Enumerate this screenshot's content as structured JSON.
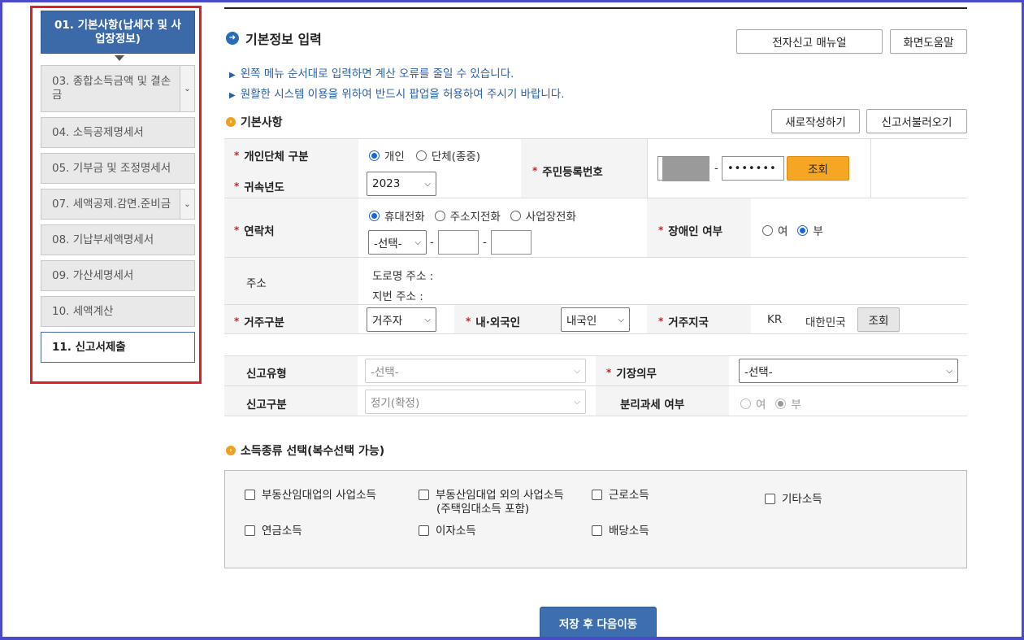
{
  "sidebar": {
    "items": [
      {
        "label": "01. 기본사항(납세자 및 사업장정보)",
        "state": "active"
      },
      {
        "label": "03. 종합소득금액 및 결손금",
        "state": "expandable"
      },
      {
        "label": "04. 소득공제명세서",
        "state": "normal"
      },
      {
        "label": "05. 기부금 및 조정명세서",
        "state": "normal"
      },
      {
        "label": "07. 세액공제.감면.준비금",
        "state": "expandable"
      },
      {
        "label": "08. 기납부세액명세서",
        "state": "normal"
      },
      {
        "label": "09. 가산세명세서",
        "state": "normal"
      },
      {
        "label": "10. 세액계산",
        "state": "normal"
      },
      {
        "label": "11. 신고서제출",
        "state": "current"
      }
    ]
  },
  "header": {
    "title": "기본정보 입력",
    "manual_button": "전자신고 매뉴얼",
    "help_button": "화면도움말",
    "notices": [
      "왼쪽 메뉴 순서대로 입력하면 계산 오류를 줄일 수 있습니다.",
      "원활한 시스템 이용을 위하여 반드시 팝업을 허용하여 주시기 바랍니다."
    ]
  },
  "basic": {
    "title": "기본사항",
    "new_button": "새로작성하기",
    "load_button": "신고서불러오기",
    "type_label": "개인단체 구분",
    "type_options": [
      "개인",
      "단체(종중)"
    ],
    "type_selected": "개인",
    "year_label": "귀속년도",
    "year_value": "2023",
    "rrn_label": "주민등록번호",
    "rrn_dash": "-",
    "rrn_masked": "•••••••",
    "rrn_lookup": "조회",
    "contact_label": "연락처",
    "contact_options": [
      "휴대전화",
      "주소지전화",
      "사업장전화"
    ],
    "contact_selected": "휴대전화",
    "phone_select": "-선택-",
    "phone_dash": "-",
    "disabled_label": "장애인 여부",
    "disabled_options": [
      "여",
      "부"
    ],
    "disabled_selected": "부",
    "address_label": "주소",
    "road_address": "도로명 주소 :",
    "lot_address": "지번 주소 :",
    "residence_label": "거주구분",
    "residence_value": "거주자",
    "nationality_label": "내·외국인",
    "nationality_value": "내국인",
    "country_label": "거주지국",
    "country_code": "KR",
    "country_name": "대한민국",
    "country_lookup": "조회"
  },
  "filing": {
    "type_label": "신고유형",
    "type_value": "-선택-",
    "bookkeeping_label": "기장의무",
    "bookkeeping_value": "-선택-",
    "category_label": "신고구분",
    "category_value": "정기(확정)",
    "separate_label": "분리과세 여부",
    "separate_options": [
      "여",
      "부"
    ],
    "separate_selected": "부"
  },
  "income": {
    "title": "소득종류 선택(복수선택 가능)",
    "items": [
      "부동산임대업의 사업소득",
      "부동산임대업 외의 사업소득",
      "(주택임대소득 포함)",
      "근로소득",
      "기타소득",
      "연금소득",
      "이자소득",
      "배당소득"
    ]
  },
  "footer": {
    "save_button": "저장 후 다음이동"
  },
  "colors": {
    "frame": "#4a4acb",
    "sidebar_highlight": "#e02020",
    "active_item": "#3c6aa8",
    "lookup_button": "#f5a623",
    "save_button": "#3d6fae",
    "notice_text": "#2a5fa8"
  }
}
